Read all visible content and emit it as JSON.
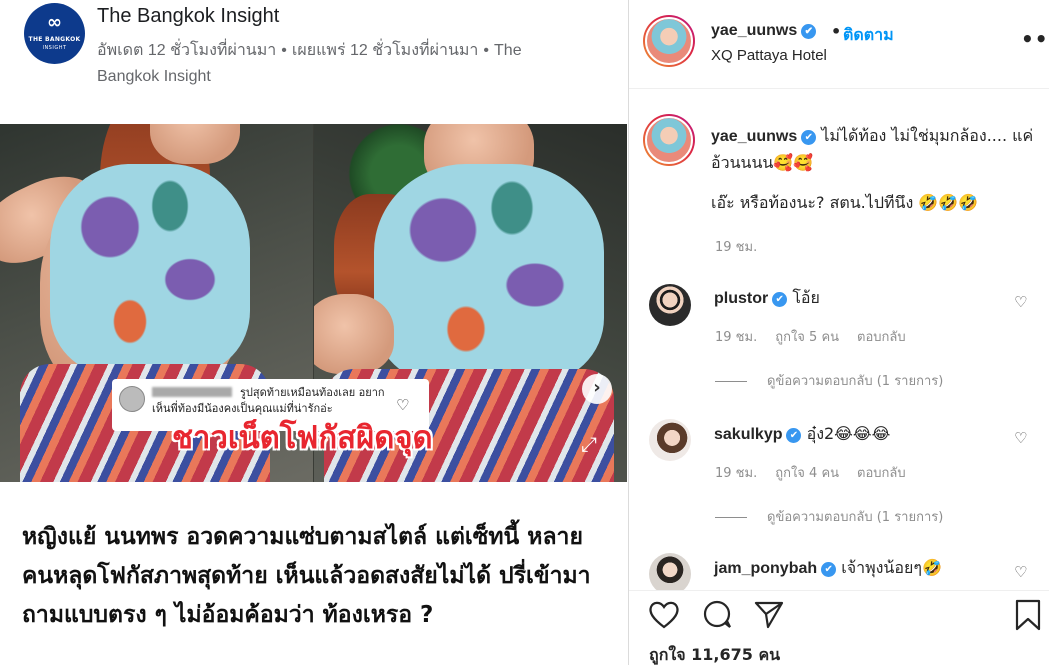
{
  "article": {
    "publisher_logo_line1": "THE BANGKOK",
    "publisher_logo_line2": "INSIGHT",
    "publisher": "The Bangkok Insight",
    "updated": "อัพเดต 12 ชั่วโมงที่ผ่านมา",
    "published": "เผยแพร่ 12 ชั่วโมงที่ผ่านมา",
    "source": "The Bangkok Insight",
    "embedded_comment_line1": "รูปสุดท้ายเหมือนท้องเลย อยาก",
    "embedded_comment_line2": "เห็นพี่ท้องมีน้องคงเป็นคุณแม่ที่น่ารักอ่ะ",
    "overlay_title": "ชาวเน็ตโฟกัสผิดจุด",
    "headline": "หญิงแย้ นนทพร อวดความแซ่บตามสไตล์ แต่เซ็ทนี้ หลายคนหลุดโฟกัสภาพสุดท้าย เห็นแล้วอดสงสัยไม่ได้ ปรี่เข้ามาถามแบบตรง ๆ ไม่อ้อมค้อมว่า ท้องเหรอ ?"
  },
  "post": {
    "username": "yae_uunws",
    "follow_label": "ติดตาม",
    "location": "XQ Pattaya Hotel",
    "caption_text": "ไม่ได้ท้อง ไม่ใช่มุมกล้อง.... แค่อ้วนนนน🥰🥰",
    "caption_text2": "เอ๊ะ หรือท้องนะ? สตน.ไปทีนึง 🤣🤣🤣",
    "caption_time": "19 ชม.",
    "likes": "ถูกใจ 11,675 คน"
  },
  "comments": [
    {
      "user": "plustor",
      "text": "โอ้ย",
      "time": "19 ชม.",
      "likes": "ถูกใจ 5 คน",
      "reply_label": "ตอบกลับ",
      "view_replies": "ดูข้อความตอบกลับ (1 รายการ)"
    },
    {
      "user": "sakulkyp",
      "text": "อุ๋ง2😂😂😂",
      "time": "19 ชม.",
      "likes": "ถูกใจ 4 คน",
      "reply_label": "ตอบกลับ",
      "view_replies": "ดูข้อความตอบกลับ (1 รายการ)"
    },
    {
      "user": "jam_ponybah",
      "text": "เจ้าพุงน้อยๆ🤣"
    }
  ],
  "icons": {
    "logo_symbol": "∞",
    "verified": "✔",
    "more": "•••",
    "next": "›",
    "expand": "⤢",
    "heart_small": "♡",
    "like": "♡",
    "comment": "◯",
    "share": "➢",
    "save": "🔖"
  },
  "colors": {
    "link_blue": "#0095f6",
    "verified_blue": "#3897f0",
    "overlay_red": "#e8262f",
    "logo_navy": "#0d3a8c"
  }
}
